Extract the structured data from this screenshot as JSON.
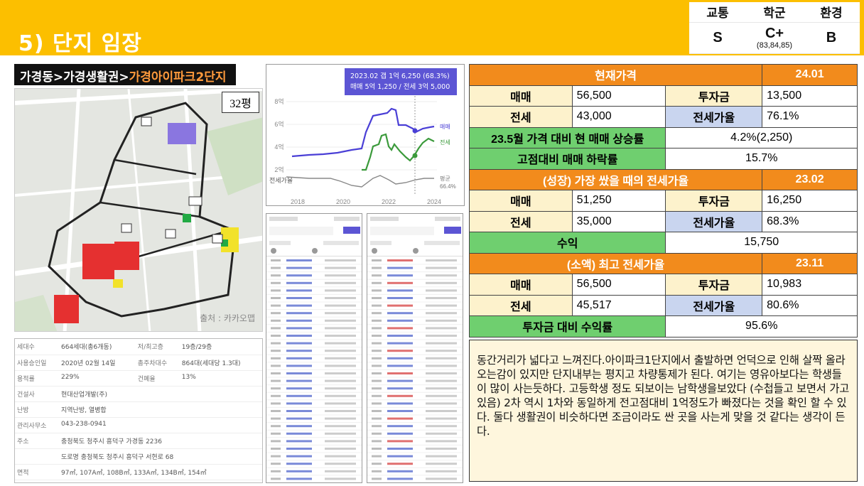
{
  "header": {
    "title": "5) 단지 임장",
    "grades": [
      {
        "label": "교통",
        "value": "S",
        "sub": ""
      },
      {
        "label": "학군",
        "value": "C+",
        "sub": "(83,84,85)"
      },
      {
        "label": "환경",
        "value": "B",
        "sub": ""
      }
    ]
  },
  "breadcrumb": {
    "path": "가경동>가경생활권>",
    "highlight": "가경아이파크2단지"
  },
  "map": {
    "size_badge": "32평",
    "credit": "출처 : 카카오맵"
  },
  "info": {
    "rows": [
      {
        "k1": "세대수",
        "v1": "664세대(총6개동)",
        "k2": "저/최고층",
        "v2": "19층/29층"
      },
      {
        "k1": "사용승인일",
        "v1": "2020년 02월 14일",
        "k2": "총주차대수",
        "v2": "864대(세대당 1.3대)"
      },
      {
        "k1": "용적률",
        "v1": "229%",
        "k2": "건폐율",
        "v2": "13%"
      },
      {
        "k1": "건설사",
        "v1": "현대산업개발(주)",
        "k2": "",
        "v2": ""
      },
      {
        "k1": "난방",
        "v1": "지역난방, 열병합",
        "k2": "",
        "v2": ""
      },
      {
        "k1": "관리사무소",
        "v1": "043-238-0941",
        "k2": "",
        "v2": ""
      },
      {
        "k1": "주소",
        "v1": "충청북도 청주시 흥덕구 가경동 2236",
        "k2": "",
        "v2": ""
      },
      {
        "k1": "",
        "v1": "도로명 충청북도 청주시 흥덕구 서현로 68",
        "k2": "",
        "v2": ""
      },
      {
        "k1": "면적",
        "v1": "97㎡, 107A㎡, 108B㎡, 133A㎡, 134B㎡, 154㎡",
        "k2": "",
        "v2": ""
      }
    ]
  },
  "price_chart": {
    "tooltip_line1": "2023.02  갭 1억 6,250 (68.3%)",
    "tooltip_line2": "매매 5억 1,250 / 전세 3억 5,000",
    "y_ticks": [
      "8억",
      "6억",
      "4억",
      "2억"
    ],
    "ratio_label": "전세가율",
    "x_ticks": [
      "2018",
      "2020",
      "2022",
      "2024"
    ],
    "legend_sale": "매매",
    "legend_lease": "전세",
    "legend_ratio": "평균",
    "legend_ratio_value": "66.4%",
    "colors": {
      "sale": "#4a3fd6",
      "lease": "#3b9a3b",
      "ratio": "#888888"
    }
  },
  "table": {
    "current": {
      "title": "현재가격",
      "date": "24.01",
      "sale": "56,500",
      "invest": "13,500",
      "lease": "43,000",
      "ratio": "76.1%"
    },
    "growth_row": {
      "label": "23.5월 가격 대비 현 매매 상승률",
      "value": "4.2%(2,250)"
    },
    "drop_row": {
      "label": "고점대비 매매 하락률",
      "value": "15.7%"
    },
    "peak": {
      "title": "(성장) 가장 쌌을 때의 전세가율",
      "date": "23.02",
      "sale": "51,250",
      "invest": "16,250",
      "lease": "35,000",
      "ratio": "68.3%"
    },
    "profit": {
      "label": "수익",
      "value": "15,750"
    },
    "low": {
      "title": "(소액) 최고 전세가율",
      "date": "23.11",
      "sale": "56,500",
      "invest": "10,983",
      "lease": "45,517",
      "ratio": "80.6%"
    },
    "return_row": {
      "label": "투자금 대비 수익률",
      "value": "95.6%"
    },
    "labels": {
      "sale": "매매",
      "invest": "투자금",
      "lease": "전세",
      "ratio": "전세가율"
    }
  },
  "comment": "동간거리가 넓다고 느껴진다.아이파크1단지에서 출발하면 언덕으로 인해 살짝 올라오는감이 있지만 단지내부는 평지고 차량통제가 된다. 여기는 영유아보다는 학생들이 많이 사는듯하다. 고등학생 정도 되보이는 남학생을보았다 (수첩들고 보면서 가고있음) 2차 역시 1차와 동일하게 전고점대비 1억정도가 빠졌다는 것을 확인 할 수 있다. 둘다 생활권이 비슷하다면 조금이라도 싼 곳을 사는게 맞을 것 같다는 생각이 든다."
}
